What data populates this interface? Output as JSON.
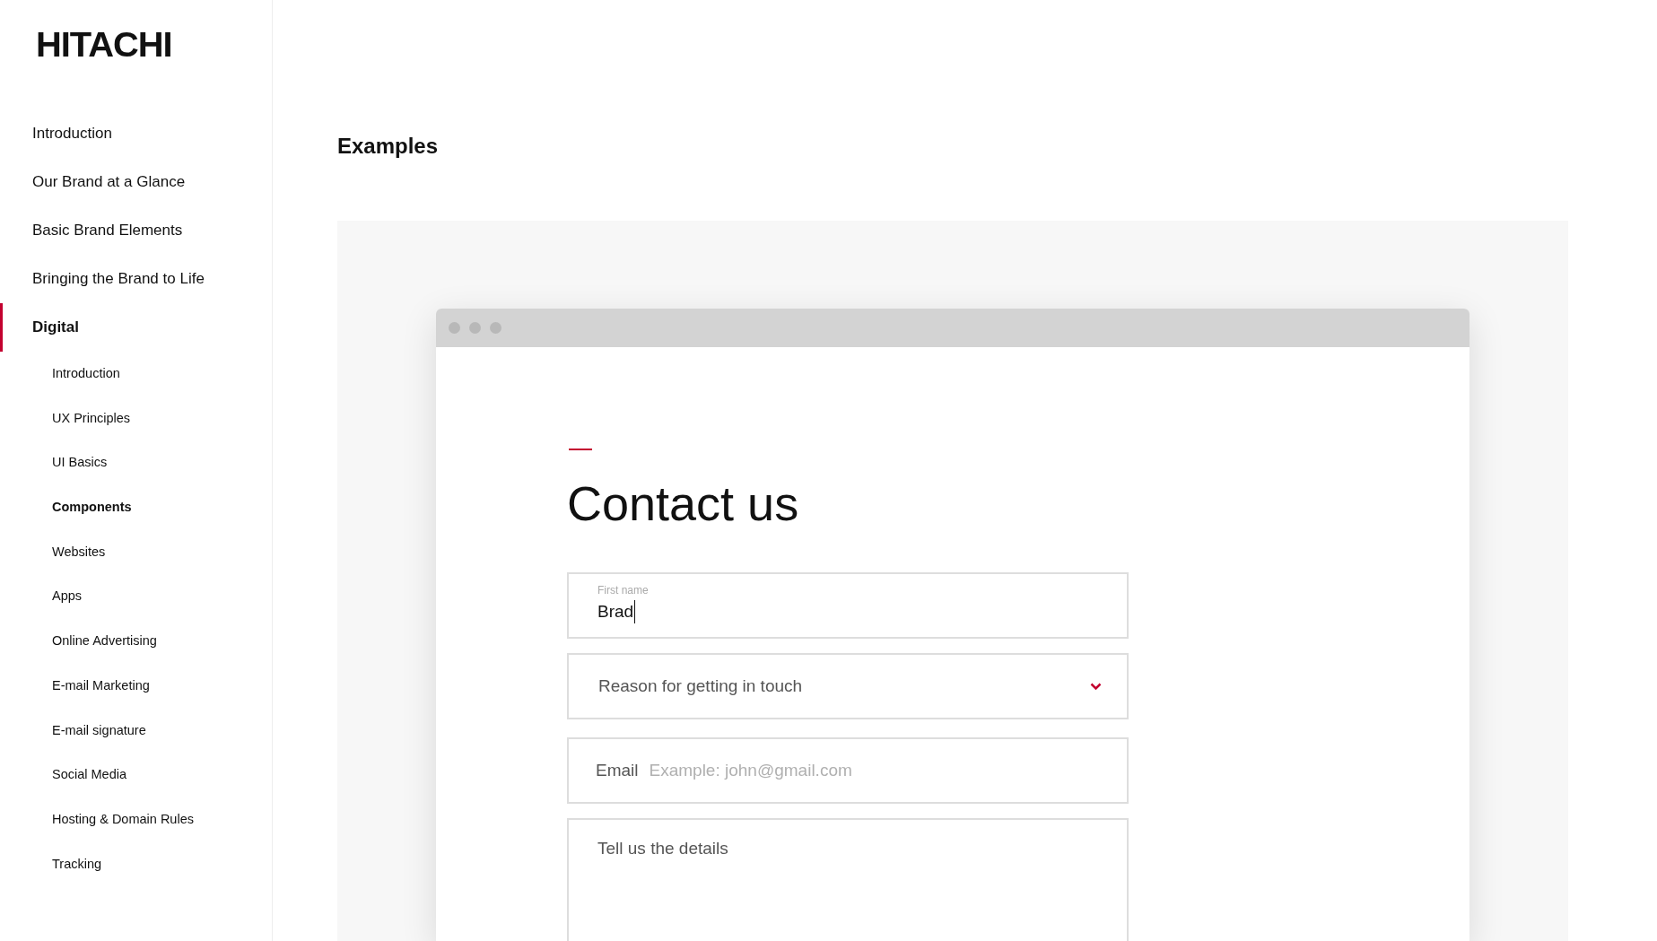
{
  "logo": "HITACHI",
  "sidebar": {
    "items": [
      {
        "label": "Introduction",
        "selected": false
      },
      {
        "label": "Our Brand at a Glance",
        "selected": false
      },
      {
        "label": "Basic Brand Elements",
        "selected": false
      },
      {
        "label": "Bringing the Brand to Life",
        "selected": false
      },
      {
        "label": "Digital",
        "selected": true,
        "children": [
          {
            "label": "Introduction",
            "selected": false
          },
          {
            "label": "UX Principles",
            "selected": false
          },
          {
            "label": "UI Basics",
            "selected": false
          },
          {
            "label": "Components",
            "selected": true
          },
          {
            "label": "Websites",
            "selected": false
          },
          {
            "label": "Apps",
            "selected": false
          },
          {
            "label": "Online Advertising",
            "selected": false
          },
          {
            "label": "E-mail Marketing",
            "selected": false
          },
          {
            "label": "E-mail signature",
            "selected": false
          },
          {
            "label": "Social Media",
            "selected": false
          },
          {
            "label": "Hosting & Domain Rules",
            "selected": false
          },
          {
            "label": "Tracking",
            "selected": false
          }
        ]
      }
    ]
  },
  "section_title": "Examples",
  "example": {
    "heading": "Contact us",
    "fields": [
      {
        "kind": "text",
        "label": "First name",
        "value": "Brad",
        "focused": true
      },
      {
        "kind": "select",
        "placeholder": "Reason for getting in touch"
      },
      {
        "kind": "email",
        "label": "Email",
        "placeholder": "Example: john@gmail.com"
      },
      {
        "kind": "textarea",
        "placeholder": "Tell us the details"
      }
    ]
  }
}
